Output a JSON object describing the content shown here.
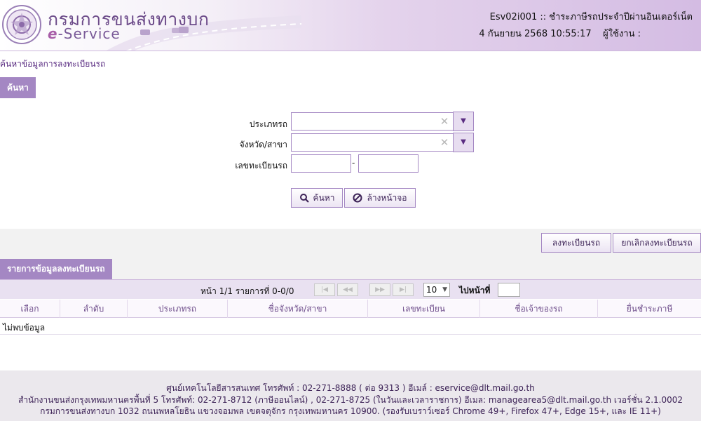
{
  "header": {
    "org_name": "กรมการขนส่งทางบก",
    "eservice_e": "e",
    "eservice_rest": "-Service",
    "program_title": "Esv02i001 :: ชำระภาษีรถประจำปีผ่านอินเตอร์เน็ต",
    "date_user": "4 กันยายน 2568 10:55:17    ผู้ใช้งาน :"
  },
  "breadcrumb": "ค้นหาข้อมูลการลงทะเบียนรถ",
  "search": {
    "tab_label": "ค้นหา",
    "vehicle_type_label": "ประเภทรถ",
    "vehicle_type_value": "",
    "province_label": "จังหวัด/สาขา",
    "province_value": "",
    "plate_label": "เลขทะเบียนรถ",
    "plate_part1": "",
    "plate_part2": "",
    "plate_separator": "-",
    "search_button": "ค้นหา",
    "clear_button": "ล้างหน้าจอ"
  },
  "actions": {
    "register_button": "ลงทะเบียนรถ",
    "cancel_register_button": "ยกเลิกลงทะเบียนรถ"
  },
  "results": {
    "tab_label": "รายการข้อมูลลงทะเบียนรถ",
    "pager_text": "หน้า 1/1 รายการที่ 0-0/0",
    "page_size": "10",
    "goto_label": "ไปหน้าที่",
    "goto_value": "",
    "columns": [
      "เลือก",
      "ลำดับ",
      "ประเภทรถ",
      "ชื่อจังหวัด/สาขา",
      "เลขทะเบียน",
      "ชื่อเจ้าของรถ",
      "ยื่นชำระภาษี"
    ],
    "no_data": "ไม่พบข้อมูล"
  },
  "footer": {
    "line1": "ศูนย์เทคโนโลยีสารสนเทศ โทรศัพท์ : 02-271-8888 ( ต่อ 9313 ) อีเมล์ : eservice@dlt.mail.go.th",
    "line2": "สำนักงานขนส่งกรุงเทพมหานครพื้นที่ 5 โทรศัพท์: 02-271-8712 (ภาษีออนไลน์) , 02-271-8725 (ในวันและเวลาราชการ) อีเมล: managearea5@dlt.mail.go.th เวอร์ชั่น 2.1.0002",
    "line3": "กรมการขนส่งทางบก 1032 ถนนพหลโยธิน แขวงจอมพล เขตจตุจักร กรุงเทพมหานคร 10900. (รองรับเบราว์เซอร์ Chrome 49+, Firefox 47+, Edge 15+, และ IE 11+)"
  },
  "icons": {
    "logo": "dlt-seal-logo",
    "search": "magnifier-icon",
    "clear": "no-entry-icon",
    "dropdown": "triangle-down-icon",
    "clear_field": "close-x-icon",
    "pager": [
      "first-page-icon",
      "prev-page-icon",
      "next-page-icon",
      "last-page-icon"
    ]
  },
  "colors": {
    "accent": "#a487c3",
    "accent_dark": "#5a2d82",
    "footer_bg": "#ebe8ed"
  }
}
